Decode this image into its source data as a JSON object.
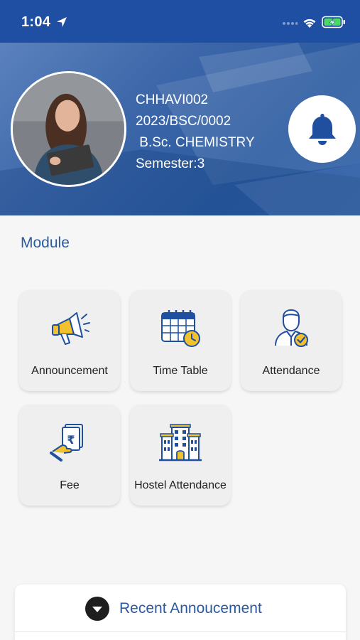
{
  "status_bar": {
    "time": "1:04",
    "icons": [
      "location-arrow-icon",
      "wifi-icon",
      "battery-charging-icon"
    ],
    "color": "#1e4fa3"
  },
  "profile": {
    "username": "CHHAVI002",
    "enrollment": "2023/BSC/0002",
    "course": " B.Sc. CHEMISTRY",
    "semester": "Semester:3",
    "notification_icon": "bell-icon"
  },
  "module": {
    "title": "Module",
    "tiles": [
      {
        "label": "Announcement",
        "icon": "megaphone-icon"
      },
      {
        "label": "Time Table",
        "icon": "calendar-clock-icon"
      },
      {
        "label": "Attendance",
        "icon": "person-check-icon"
      },
      {
        "label": "Fee",
        "icon": "rupee-receipt-icon"
      },
      {
        "label": "Hostel Attendance",
        "icon": "building-icon"
      }
    ]
  },
  "recent": {
    "title": "Recent Annoucement",
    "toggle_icon": "chevron-down-icon"
  },
  "colors": {
    "primary": "#2a5aa0",
    "accent_yellow": "#f2c12e",
    "icon_blue": "#1f4f9e",
    "background": "#f6f6f7",
    "tile": "#efefef"
  }
}
